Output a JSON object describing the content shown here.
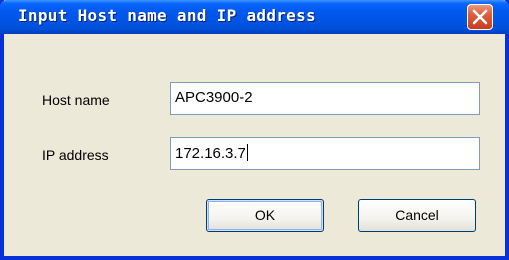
{
  "dialog": {
    "title": "Input Host name and IP address",
    "close_icon": "close-icon"
  },
  "form": {
    "host_name_label": "Host name",
    "host_name_value": "APC3900-2",
    "ip_address_label": "IP address",
    "ip_address_value": "172.16.3.7"
  },
  "buttons": {
    "ok_label": "OK",
    "cancel_label": "Cancel"
  },
  "colors": {
    "titlebar": "#0055e5",
    "close_button": "#e0603f",
    "dialog_background": "#ece9d8",
    "field_border": "#7f9db9"
  }
}
